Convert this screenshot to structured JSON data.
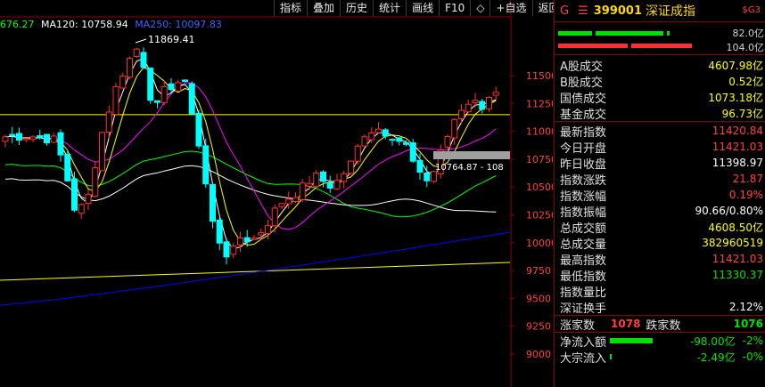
{
  "toolbar": {
    "items": [
      "指标",
      "叠加",
      "历史",
      "统计",
      "画线",
      "F10",
      "◇",
      "+自选",
      "返回"
    ]
  },
  "legend": {
    "ma60": "676.27",
    "ma120": "MA120: 10758.94",
    "ma250": "MA250: 10097.83"
  },
  "chart_data": {
    "type": "candlestick",
    "y_ticks": [
      "11500",
      "11250",
      "11000",
      "10750",
      "10500",
      "10250",
      "10000",
      "9750",
      "9500",
      "9250",
      "9000"
    ],
    "ylim": [
      9000,
      11550
    ],
    "annotations": {
      "high_label": "11869.41",
      "box_label": "10764.87 - 108"
    },
    "horizontal_lines": [
      11150,
      10870,
      9840
    ]
  },
  "colors": {
    "up": "#ff3030",
    "down": "#00ffff",
    "ma5": "#ffffff",
    "ma10": "#ffff00",
    "ma20": "#ff00ff",
    "ma60": "#00ff00",
    "ma120": "#ffffff",
    "ma250": "#0000ff",
    "line": "#ffff00"
  },
  "panel": {
    "header": {
      "g": "G",
      "menu": "☰",
      "code": "399001",
      "name": "深证成指",
      "badge": "$G3"
    },
    "bars": [
      {
        "value": "82.0亿"
      },
      {
        "value": "104.0亿"
      }
    ],
    "trades": [
      {
        "label": "A股成交",
        "value": "4607.98亿"
      },
      {
        "label": "B股成交",
        "value": "0.52亿"
      },
      {
        "label": "国债成交",
        "value": "1073.18亿"
      },
      {
        "label": "基金成交",
        "value": "96.73亿"
      }
    ],
    "stats": [
      {
        "label": "最新指数",
        "value": "11420.84",
        "color": "#ff4040"
      },
      {
        "label": "今日开盘",
        "value": "11421.03",
        "color": "#ff4040"
      },
      {
        "label": "昨日收盘",
        "value": "11398.97",
        "color": "#ffffff"
      },
      {
        "label": "指数涨跌",
        "value": "21.87",
        "color": "#ff4040"
      },
      {
        "label": "指数涨幅",
        "value": "0.19%",
        "color": "#ff4040"
      },
      {
        "label": "指数振幅",
        "value": "90.66/0.80%",
        "color": "#ffffff"
      },
      {
        "label": "总成交额",
        "value": "4608.50亿",
        "color": "#ffff00"
      },
      {
        "label": "总成交量",
        "value": "382960519",
        "color": "#ffff00"
      },
      {
        "label": "最高指数",
        "value": "11421.03",
        "color": "#ff4040"
      },
      {
        "label": "最低指数",
        "value": "11330.37",
        "color": "#00e000"
      },
      {
        "label": "指数量比",
        "value": "",
        "color": "#ffffff"
      },
      {
        "label": "深证换手",
        "value": "2.12%",
        "color": "#ffffff"
      }
    ],
    "updown": {
      "up_label": "涨家数",
      "up_value": "1078",
      "down_label": "跌家数",
      "down_value": "1076"
    },
    "flows": [
      {
        "label": "净流入额",
        "value": "-98.00亿",
        "pct": "-2%"
      },
      {
        "label": "大宗流入",
        "value": "-2.49亿",
        "pct": "-0%"
      }
    ]
  }
}
